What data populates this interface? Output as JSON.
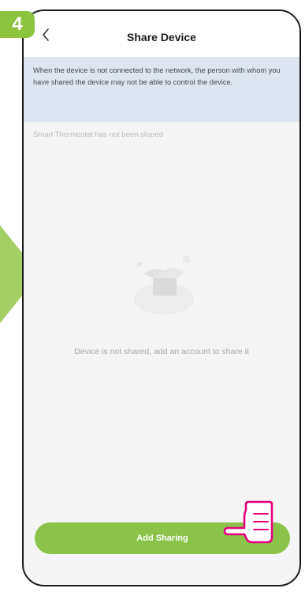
{
  "step_badge": "4",
  "header": {
    "title": "Share Device",
    "back_icon": "chevron-left-icon"
  },
  "notice": {
    "text": "When the device is not connected to the network, the person with whom you have shared the device may not be able to control the device."
  },
  "share_status": {
    "text": "Smart Thermostat  has not been shared"
  },
  "empty_state": {
    "illustration": "empty-box-icon",
    "text": "Device is not shared, add an account to share it"
  },
  "add_button": {
    "label": "Add Sharing"
  },
  "annotation": {
    "hand_icon": "pointing-hand-icon",
    "arrow_icon": "right-arrow-icon"
  },
  "colors": {
    "accent_green": "#8bc34a",
    "badge_green": "#8cc43e",
    "arrow_green": "#a6ce67",
    "notice_bg": "#dde6f0",
    "screen_bg": "#f5f5f5",
    "hand_outline": "#e6007e"
  }
}
